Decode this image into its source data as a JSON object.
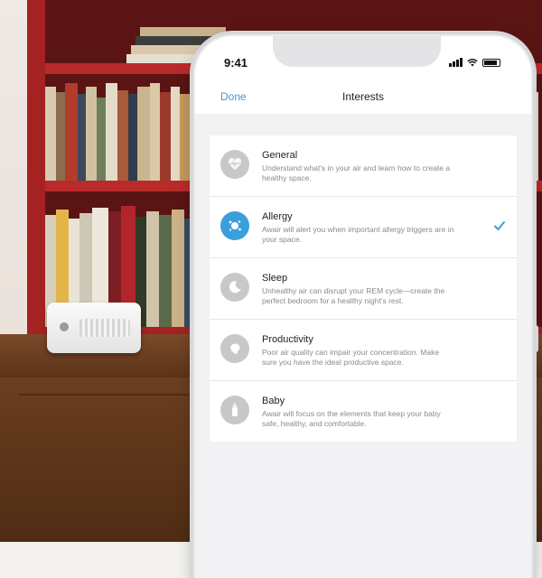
{
  "status_bar": {
    "time": "9:41"
  },
  "nav": {
    "done_label": "Done",
    "title": "Interests"
  },
  "accent_color": "#3c9fdb",
  "interests": [
    {
      "title": "General",
      "description": "Understand what's in your air and learn how to create a healthy space.",
      "icon": "heart-pulse-icon",
      "selected": false
    },
    {
      "title": "Allergy",
      "description": "Awair will alert you when important allergy triggers are in your space.",
      "icon": "allergen-icon",
      "selected": true
    },
    {
      "title": "Sleep",
      "description": "Unhealthy air can disrupt your REM cycle—create the perfect bedroom for a healthy night's rest.",
      "icon": "moon-icon",
      "selected": false
    },
    {
      "title": "Productivity",
      "description": "Poor air quality can impair your concentration. Make sure you have the ideal productive space.",
      "icon": "brain-icon",
      "selected": false
    },
    {
      "title": "Baby",
      "description": "Awair will focus on the elements that keep your baby safe, healthy, and comfortable.",
      "icon": "baby-bottle-icon",
      "selected": false
    }
  ]
}
